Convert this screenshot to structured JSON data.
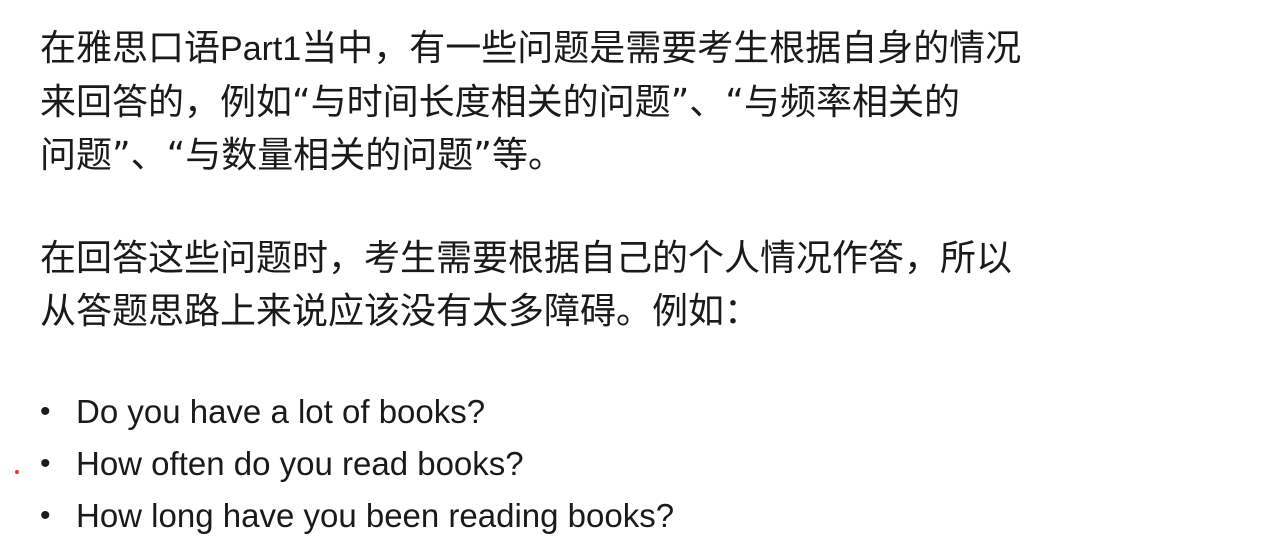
{
  "paragraph1": {
    "line1_prefix": "在雅思口语",
    "line1_latin": "Part1",
    "line1_suffix": "当中，有一些问题是需要考生根据自身的情况",
    "line2": "来回答的，例如“与时间长度相关的问题”、“与频率相关的",
    "line3": "问题”、“与数量相关的问题”等。"
  },
  "paragraph2": {
    "line1": "在回答这些问题时，考生需要根据自己的个人情况作答，所以",
    "line2": "从答题思路上来说应该没有太多障碍。例如："
  },
  "bullet_symbol": "•",
  "bullets": [
    "Do you have a lot of books?",
    "How often do you read books?",
    "How long have you been reading books?"
  ],
  "colors": {
    "text": "#1a1a1a",
    "marker": "#e03a2f",
    "background": "#ffffff"
  }
}
